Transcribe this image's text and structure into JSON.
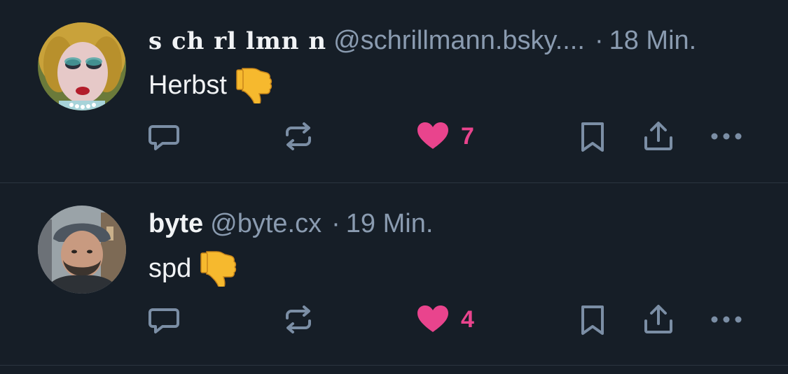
{
  "colors": {
    "background": "#161e27",
    "divider": "#2b3540",
    "text_primary": "#f1f3f5",
    "text_secondary": "#8a9bb0",
    "icon": "#7b8ea5",
    "like": "#e9448d",
    "emoji": "#f6b92e"
  },
  "posts": [
    {
      "display_name": "s ch rl lmn n",
      "handle": "@schrillmann.bsky....",
      "separator": "·",
      "time": "18 Min.",
      "text": "Herbst",
      "emoji": "thumbs-down-icon",
      "like_count": "7",
      "liked": true,
      "avatar": "avatar-photo-woman-blonde-hair"
    },
    {
      "display_name": "byte",
      "handle": "@byte.cx",
      "separator": "·",
      "time": "19 Min.",
      "text": "spd",
      "emoji": "thumbs-down-icon",
      "like_count": "4",
      "liked": true,
      "avatar": "avatar-photo-man-bucket-hat"
    }
  ],
  "action_icons": [
    "reply-icon",
    "repost-icon",
    "like-heart-icon",
    "bookmark-icon",
    "share-icon",
    "more-icon"
  ]
}
